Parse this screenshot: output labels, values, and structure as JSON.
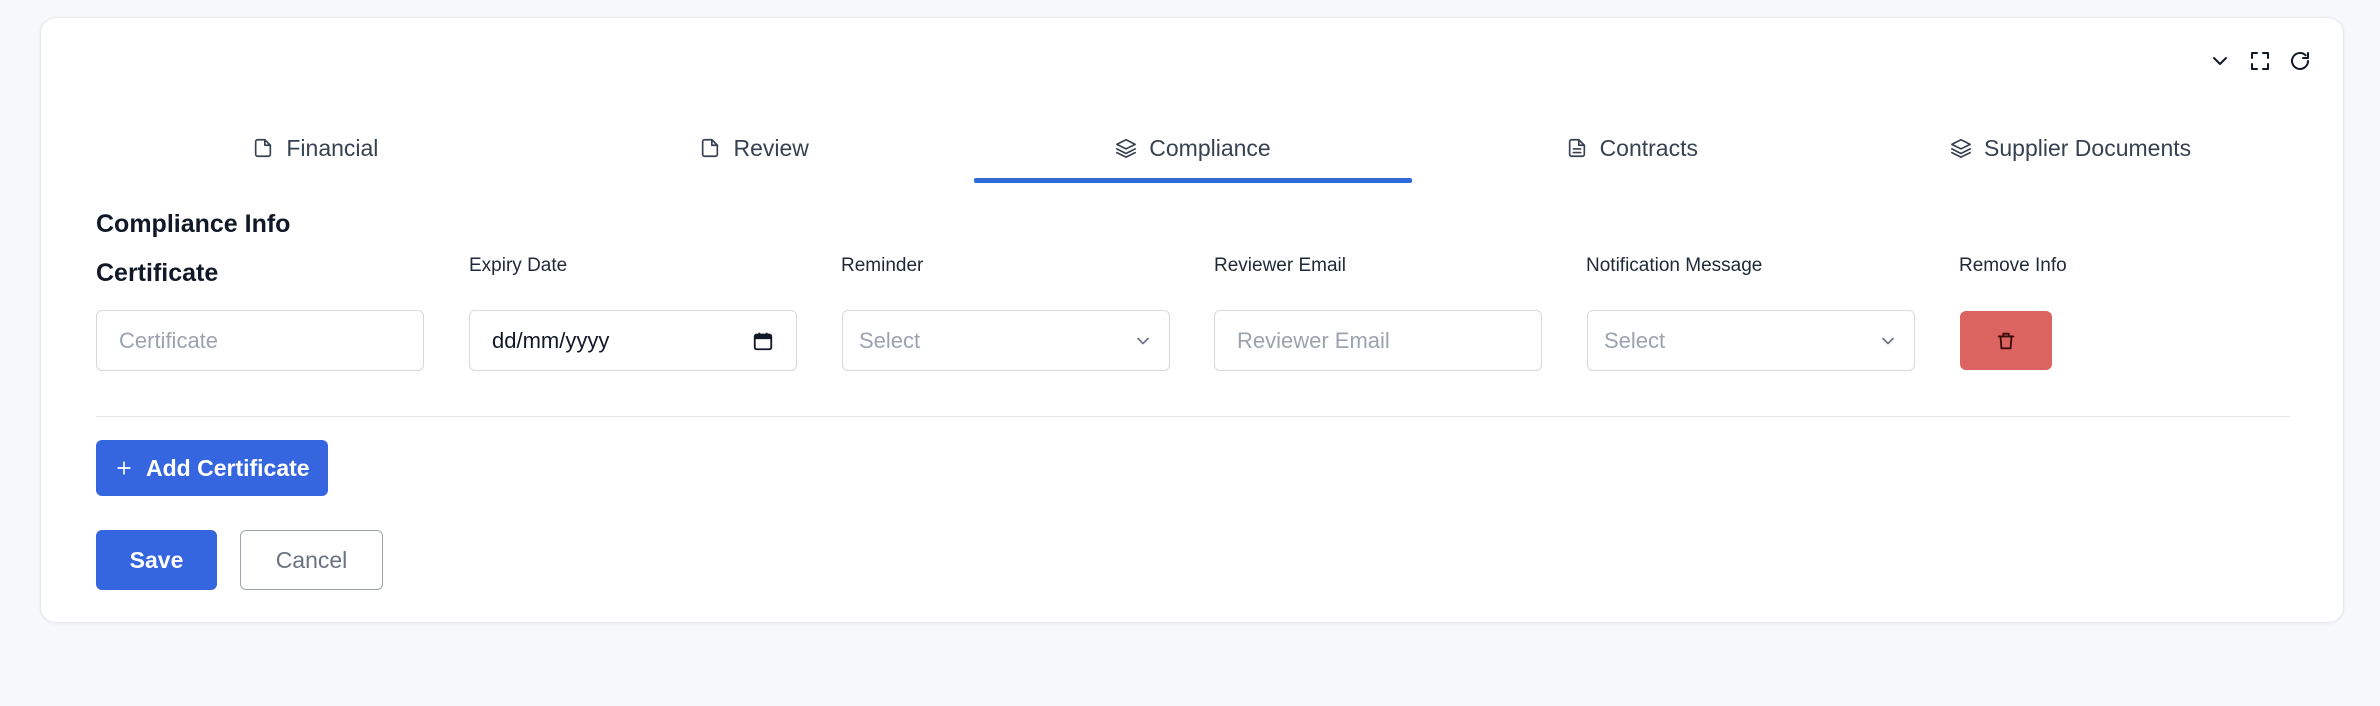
{
  "tabs": [
    {
      "label": "Financial",
      "icon": "file-icon",
      "active": false
    },
    {
      "label": "Review",
      "icon": "file-icon",
      "active": false
    },
    {
      "label": "Compliance",
      "icon": "layers-icon",
      "active": true
    },
    {
      "label": "Contracts",
      "icon": "file-text-icon",
      "active": false
    },
    {
      "label": "Supplier Documents",
      "icon": "layers-icon",
      "active": false
    }
  ],
  "section": {
    "title": "Compliance Info",
    "certificate_label": "Certificate"
  },
  "columns": {
    "expiry_date": "Expiry Date",
    "reminder": "Reminder",
    "reviewer_email": "Reviewer Email",
    "notification_message": "Notification Message",
    "remove_info": "Remove Info"
  },
  "fields": {
    "certificate_placeholder": "Certificate",
    "expiry_date_value": "dd/mm/yyyy",
    "reminder_placeholder": "Select",
    "reviewer_email_placeholder": "Reviewer Email",
    "notification_placeholder": "Select"
  },
  "actions": {
    "add_certificate": "Add Certificate",
    "save": "Save",
    "cancel": "Cancel"
  },
  "colors": {
    "accent": "#3566e0",
    "tab_underline": "#2f6bd8",
    "danger": "#dc6460"
  }
}
